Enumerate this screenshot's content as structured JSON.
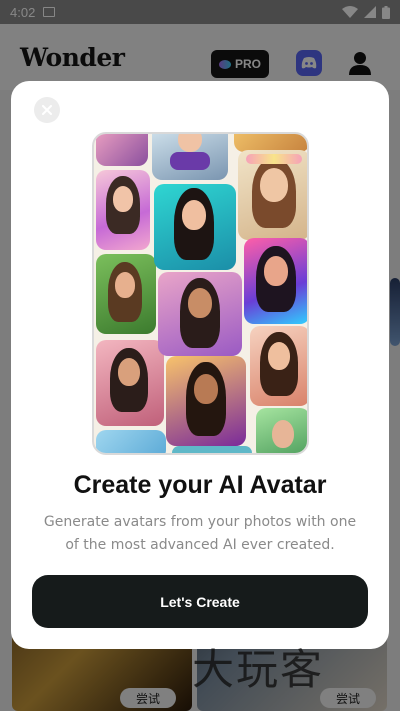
{
  "status_bar": {
    "time": "4:02"
  },
  "header": {
    "logo": "Wonder",
    "pro_label": "PRO"
  },
  "modal": {
    "title": "Create your AI Avatar",
    "description": "Generate avatars from your photos with one of the most advanced AI ever created.",
    "cta_label": "Let's Create"
  },
  "background": {
    "try_label_1": "尝试",
    "try_label_2": "尝试"
  },
  "watermark": "大玩客",
  "colors": {
    "cta": "#161b1b",
    "discord": "#5865f2",
    "pro_bg": "#151515"
  },
  "icons": [
    "gallery-icon",
    "wifi-icon",
    "signal-icon",
    "battery-icon",
    "pro-icon",
    "discord-icon",
    "user-icon",
    "close-icon"
  ]
}
